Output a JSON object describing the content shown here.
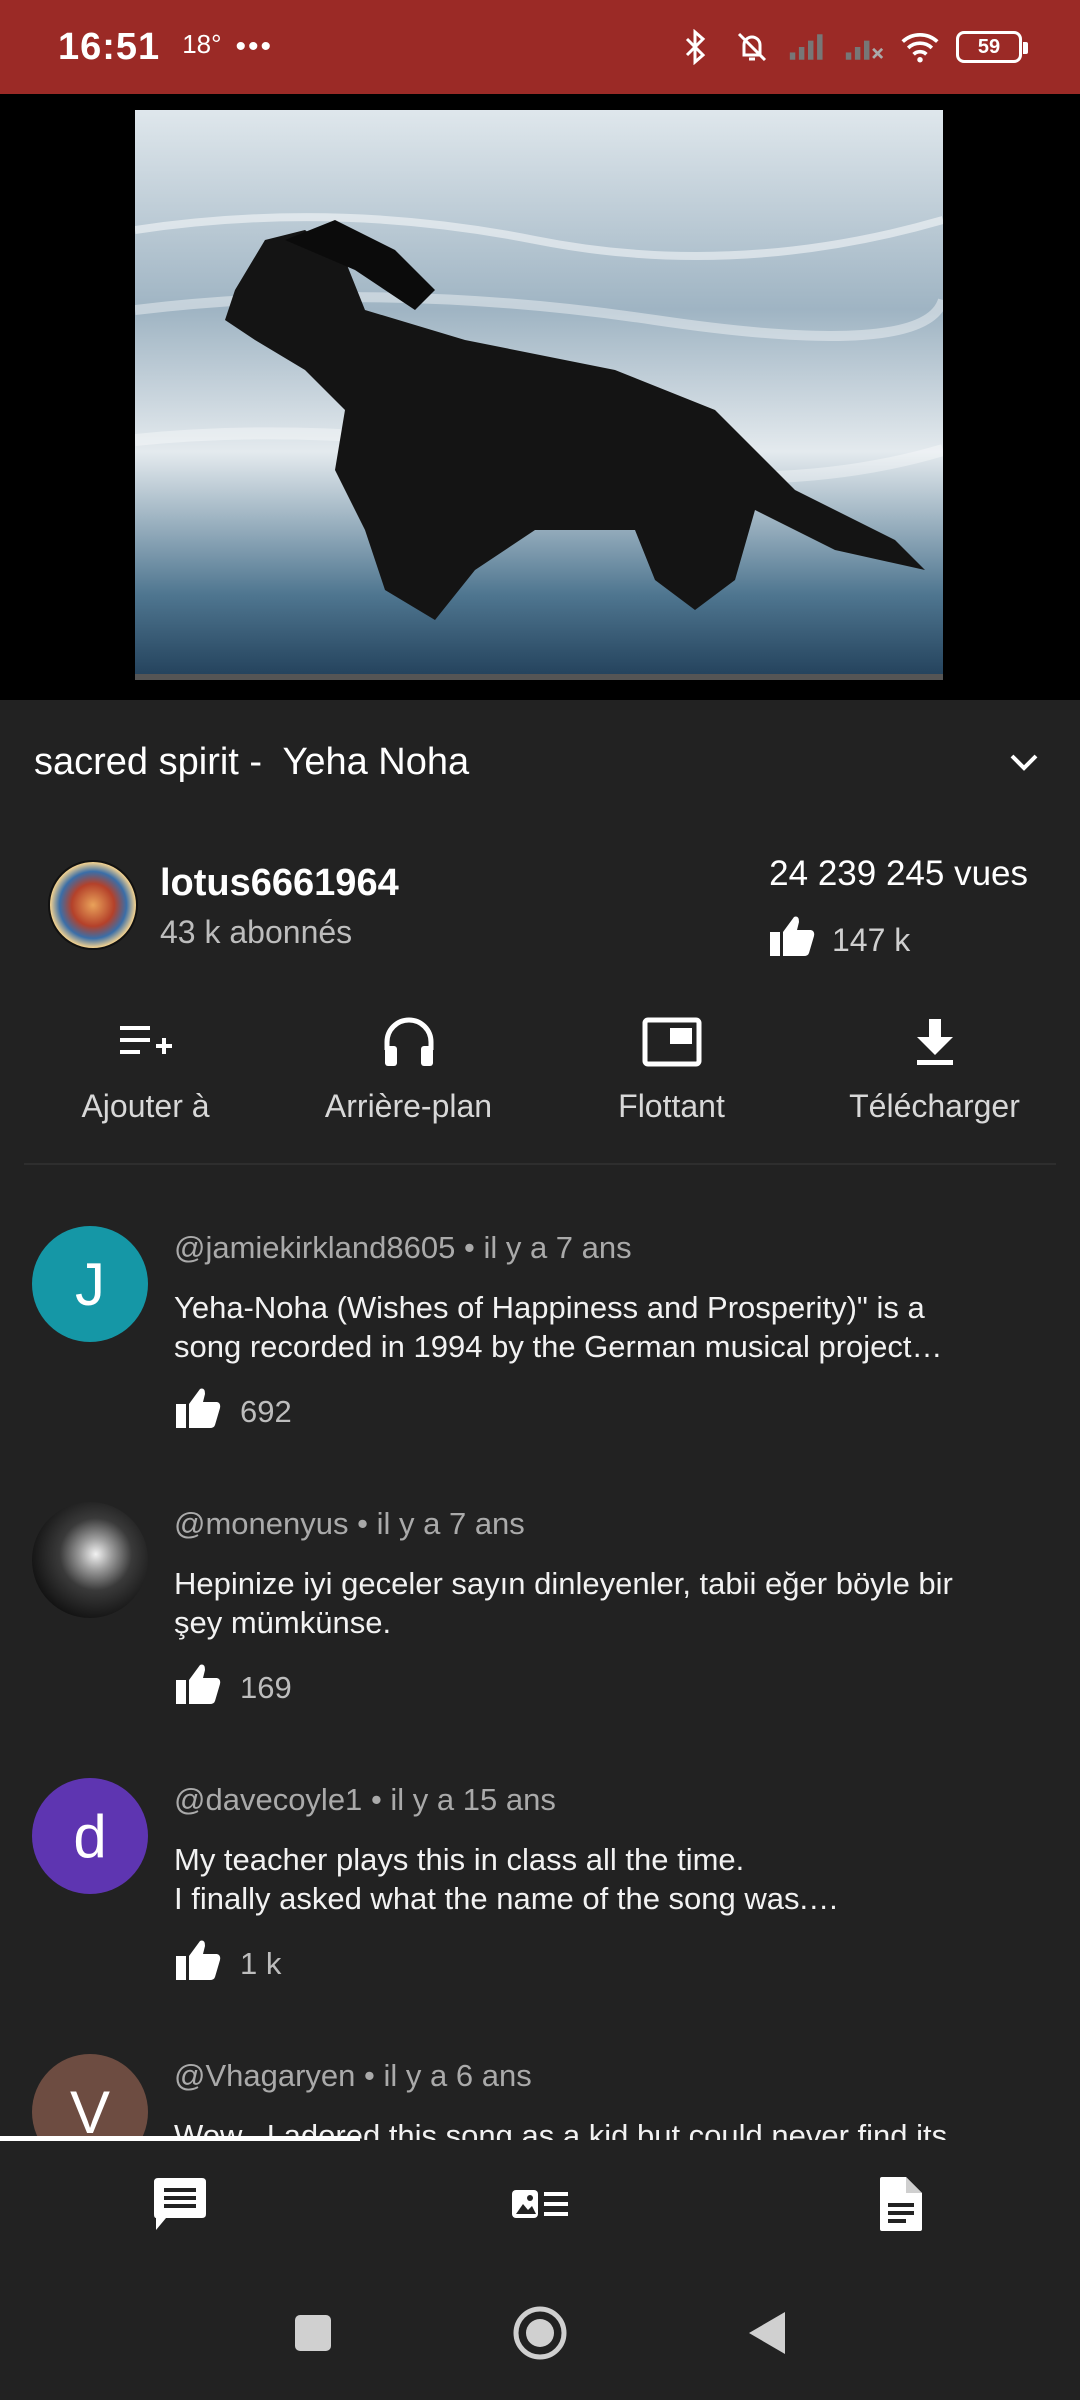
{
  "status_bar": {
    "time": "16:51",
    "temperature": "18°",
    "more": "•••",
    "battery": "59",
    "icons": [
      "bluetooth-icon",
      "bell-muted-icon",
      "signal-icon",
      "signal-no-icon",
      "wifi-icon",
      "battery-icon"
    ]
  },
  "video": {
    "thumbnail_description": "black horse running in ocean surf"
  },
  "title": {
    "text": "sacred spirit -  Yeha Noha"
  },
  "channel": {
    "name": "lotus6661964",
    "subscribers": "43 k abonnés",
    "views": "24 239 245 vues",
    "likes": "147 k"
  },
  "actions": [
    {
      "label": "Ajouter à",
      "icon": "playlist-add-icon"
    },
    {
      "label": "Arrière-plan",
      "icon": "headphones-icon"
    },
    {
      "label": "Flottant",
      "icon": "picture-in-picture-icon"
    },
    {
      "label": "Télécharger",
      "icon": "download-icon"
    }
  ],
  "comments": [
    {
      "author": "@jamiekirkland8605",
      "time": "il y a 7 ans",
      "avatar_letter": "J",
      "avatar_color": "#1597a6",
      "line1": "Yeha-Noha (Wishes of Happiness and Prosperity)\" is a",
      "line2": "song recorded in 1994 by the German musical project…",
      "likes": "692"
    },
    {
      "author": "@monenyus",
      "time": "il y a 7 ans",
      "avatar_letter": "",
      "avatar_color": "#2a2a2a",
      "line1": "Hepinize iyi geceler sayın dinleyenler, tabii eğer böyle bir",
      "line2": "şey mümkünse.",
      "likes": "169"
    },
    {
      "author": "@davecoyle1",
      "time": "il y a 15 ans",
      "avatar_letter": "d",
      "avatar_color": "#5e35b1",
      "line1": "My teacher plays this in class all the time.",
      "line2": "I finally asked what the name of the song was.…",
      "likes": "1 k"
    },
    {
      "author": "@Vhagaryen",
      "time": "il y a 6 ans",
      "avatar_letter": "V",
      "avatar_color": "#6d4c41",
      "line1": "Wow...I adored this song as a kid but could never find its",
      "line2": "",
      "likes": ""
    }
  ],
  "separator": "•",
  "tabs": [
    {
      "name": "comments-tab",
      "icon": "comment-icon"
    },
    {
      "name": "related-tab",
      "icon": "related-videos-icon"
    },
    {
      "name": "description-tab",
      "icon": "document-icon"
    }
  ],
  "colors": {
    "status_bar": "#9b2a26",
    "background": "#222222",
    "text_secondary": "#aaaaaa"
  }
}
